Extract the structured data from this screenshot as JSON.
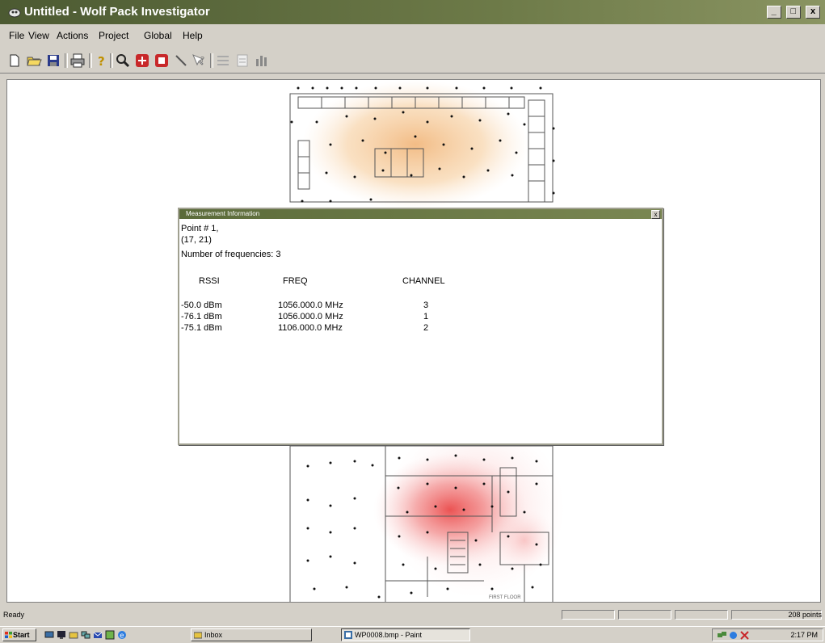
{
  "window": {
    "title": "Untitled - Wolf Pack Investigator",
    "minimize": "_",
    "maximize": "□",
    "close": "x"
  },
  "menu": [
    {
      "label": "File"
    },
    {
      "label": "View"
    },
    {
      "label": "Actions"
    },
    {
      "label": "Project"
    },
    {
      "label": "Global"
    },
    {
      "label": "Help"
    }
  ],
  "toolbar": [
    "new-icon",
    "open-icon",
    "save-icon",
    "print-icon",
    "help-icon",
    "zoom-icon",
    "survey-icon",
    "stop-icon",
    "line-icon",
    "whats-this-icon",
    "list-icon",
    "report-icon",
    "chart-icon"
  ],
  "floor_label": "FIRST FLOOR",
  "dialog": {
    "title": "Measurement Information",
    "close": "x",
    "point_line": "Point # 1,",
    "coord_line": "(17, 21)",
    "freq_line": "Number of frequencies: 3",
    "headers": {
      "rssi": "RSSI",
      "freq": "FREQ",
      "channel": "CHANNEL"
    },
    "rows": [
      {
        "rssi": "-50.0 dBm",
        "freq": "1056.000.0 MHz",
        "channel": "3"
      },
      {
        "rssi": "-76.1 dBm",
        "freq": "1056.000.0 MHz",
        "channel": "1"
      },
      {
        "rssi": "-75.1 dBm",
        "freq": "1106.000.0 MHz",
        "channel": "2"
      }
    ]
  },
  "status": {
    "text": "Ready",
    "right": "208 points"
  },
  "taskbar": {
    "start": "Start",
    "tasks": [
      {
        "label": "Inbox"
      },
      {
        "label": "WP0008.bmp - Paint"
      }
    ],
    "clock": "2:17 PM"
  }
}
